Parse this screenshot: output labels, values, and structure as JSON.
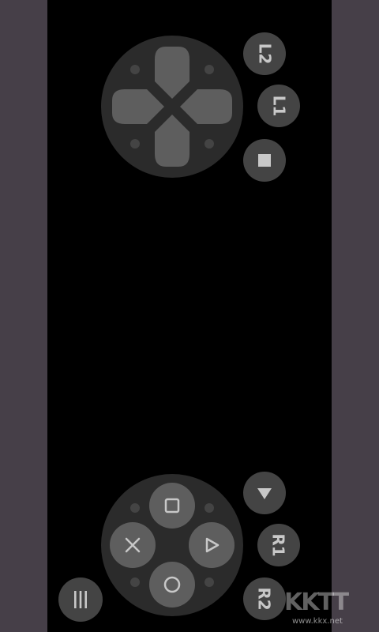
{
  "left_shoulder": {
    "l2_label": "L2",
    "l1_label": "L1",
    "select_icon": "square-stop-icon"
  },
  "right_shoulder": {
    "start_icon": "triangle-down-icon",
    "r1_label": "R1",
    "r2_label": "R2"
  },
  "dpad": {
    "icons": [
      "arrow-up-icon",
      "arrow-left-icon",
      "arrow-right-icon",
      "arrow-down-icon"
    ]
  },
  "face_buttons": {
    "icons": [
      "square-icon",
      "cross-icon",
      "triangle-icon",
      "circle-icon"
    ]
  },
  "menu": {
    "icon": "menu-bars-icon"
  },
  "watermark": {
    "logo_text": "KKTT",
    "url_text": "www.kkx.net"
  },
  "colors": {
    "side_bar": "#463f48",
    "background": "#000000",
    "pad_base": "#2b2b2b",
    "button": "#444444",
    "button_light": "#5e5e5e",
    "icon": "#c8c8c8"
  }
}
